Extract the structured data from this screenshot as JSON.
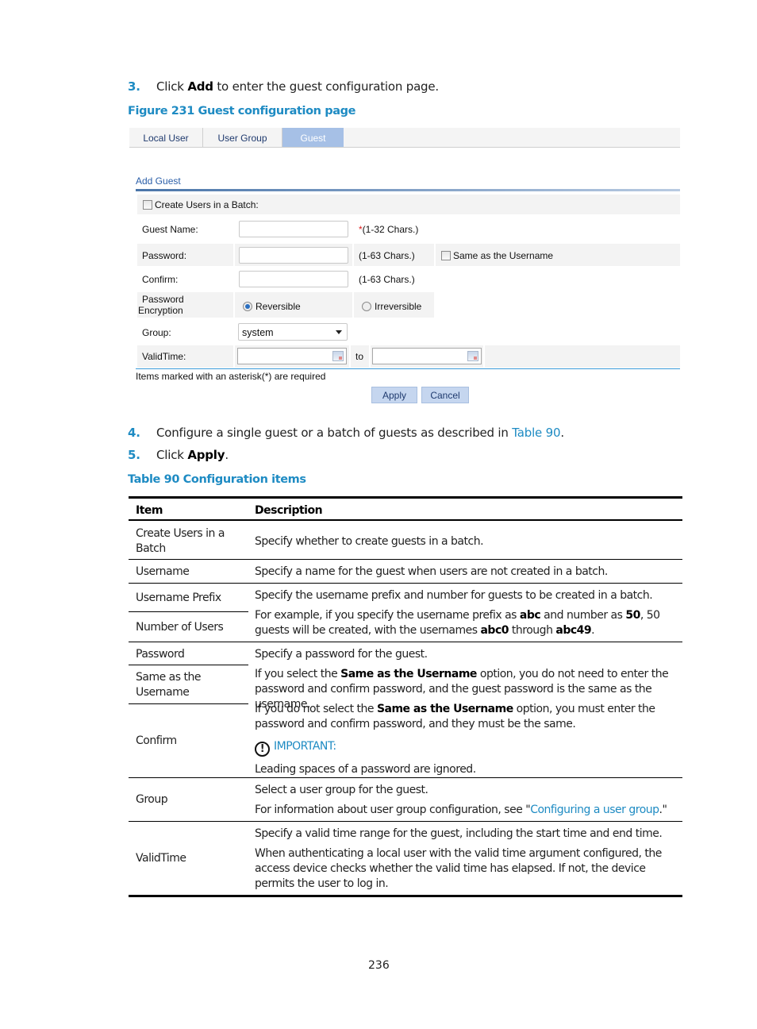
{
  "steps": {
    "step3": {
      "num": "3.",
      "pre": "Click ",
      "bold": "Add",
      "post": " to enter the guest configuration page."
    },
    "step4": {
      "num": "4.",
      "pre": "Configure a single guest or a batch of guests as described in ",
      "link": "Table 90",
      "post": "."
    },
    "step5": {
      "num": "5.",
      "pre": "Click ",
      "bold": "Apply",
      "post": "."
    }
  },
  "figure_caption": "Figure 231 Guest configuration page",
  "ui": {
    "tabs": [
      {
        "label": "Local User",
        "active": false
      },
      {
        "label": "User Group",
        "active": false
      },
      {
        "label": "Guest",
        "active": true
      }
    ],
    "section_title": "Add Guest",
    "batch_label": "Create Users in a Batch:",
    "guest_name": {
      "label": "Guest Name:",
      "value": "",
      "required_mark": "*",
      "hint": "(1-32 Chars.)"
    },
    "password": {
      "label": "Password:",
      "value": "",
      "hint": "(1-63 Chars.)",
      "same_label": "Same as the Username"
    },
    "confirm": {
      "label": "Confirm:",
      "value": "",
      "hint": "(1-63 Chars.)"
    },
    "encryption": {
      "label_line1": "Password",
      "label_line2": "Encryption",
      "option1": "Reversible",
      "option2": "Irreversible",
      "selected": "Reversible"
    },
    "group": {
      "label": "Group:",
      "value": "system"
    },
    "valid_time": {
      "label": "ValidTime:",
      "from": "",
      "to_label": "to",
      "to": ""
    },
    "required_note": "Items marked with an asterisk(*) are required",
    "apply_label": "Apply",
    "cancel_label": "Cancel"
  },
  "table_caption": "Table 90 Configuration items",
  "table": {
    "headers": [
      "Item",
      "Description"
    ],
    "rows": {
      "batch": {
        "item": "Create Users in a Batch",
        "desc": "Specify whether to create guests in a batch."
      },
      "username": {
        "item": "Username",
        "desc": "Specify a name for the guest when users are not created in a batch."
      },
      "prefix": {
        "item": "Username Prefix",
        "desc": "Specify the username prefix and number for guests to be created in a batch."
      },
      "number": {
        "item": "Number of Users",
        "desc_a": "For example, if you specify the username prefix as ",
        "b1": "abc",
        "desc_b": " and number as ",
        "b2": "50",
        "desc_c": ", 50 guests will be created, with the usernames ",
        "b3": "abc0",
        "desc_d": " through ",
        "b4": "abc49",
        "desc_e": "."
      },
      "password": {
        "item": "Password",
        "desc": "Specify a password for the guest."
      },
      "same": {
        "item": "Same as the Username",
        "desc_a": "If you select the ",
        "bold": "Same as the Username",
        "desc_b": " option, you do not need to enter the password and confirm password, and the guest password is the same as the username."
      },
      "confirm": {
        "item": "Confirm",
        "desc_a": "If you do not select the ",
        "bold": "Same as the Username",
        "desc_b": " option, you must enter the password and confirm password, and they must be the same.",
        "important": "IMPORTANT:",
        "important_icon": "!",
        "note": "Leading spaces of a password are ignored."
      },
      "group": {
        "item": "Group",
        "desc1": "Select a user group for the guest.",
        "desc2_a": "For information about user group configuration, see \"",
        "link": "Configuring a user group",
        "desc2_b": ".\""
      },
      "validtime": {
        "item": "ValidTime",
        "desc1": "Specify a valid time range for the guest, including the start time and end time.",
        "desc2": "When authenticating a local user with the valid time argument configured, the access device checks whether the valid time has elapsed. If not, the device permits the user to log in."
      }
    }
  },
  "page_number": "236"
}
